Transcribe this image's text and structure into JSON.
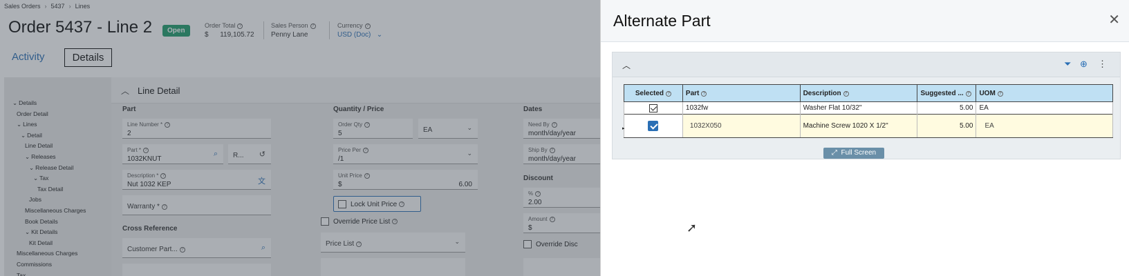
{
  "breadcrumb": [
    "Sales Orders",
    "5437",
    "Lines"
  ],
  "page": {
    "title": "Order 5437 - Line 2",
    "status": "Open",
    "order_total_label": "Order Total",
    "order_total_currency": "$",
    "order_total_value": "119,105.72",
    "sales_person_label": "Sales Person",
    "sales_person_value": "Penny Lane",
    "currency_label": "Currency",
    "currency_value": "USD (Doc)"
  },
  "tabs": {
    "activity": "Activity",
    "details": "Details"
  },
  "tree": [
    {
      "label": "Details",
      "indent": 0,
      "toggle": "⌄"
    },
    {
      "label": "Order Detail",
      "indent": 1,
      "toggle": ""
    },
    {
      "label": "Lines",
      "indent": 1,
      "toggle": "⌄"
    },
    {
      "label": "Detail",
      "indent": 2,
      "toggle": "⌄"
    },
    {
      "label": "Line Detail",
      "indent": 3,
      "toggle": ""
    },
    {
      "label": "Releases",
      "indent": 3,
      "toggle": "⌄"
    },
    {
      "label": "Release Detail",
      "indent": 4,
      "toggle": "⌄"
    },
    {
      "label": "Tax",
      "indent": 5,
      "toggle": "⌄"
    },
    {
      "label": "Tax Detail",
      "indent": 6,
      "toggle": ""
    },
    {
      "label": "Jobs",
      "indent": 4,
      "toggle": ""
    },
    {
      "label": "Miscellaneous Charges",
      "indent": 3,
      "toggle": ""
    },
    {
      "label": "Book Details",
      "indent": 3,
      "toggle": ""
    },
    {
      "label": "Kit Details",
      "indent": 3,
      "toggle": "⌄"
    },
    {
      "label": "Kit Detail",
      "indent": 4,
      "toggle": ""
    },
    {
      "label": "Miscellaneous Charges",
      "indent": 1,
      "toggle": ""
    },
    {
      "label": "Commissions",
      "indent": 1,
      "toggle": ""
    },
    {
      "label": "Tax",
      "indent": 1,
      "toggle": ""
    }
  ],
  "line_detail": {
    "section": "Line Detail",
    "part_head": "Part",
    "line_number_label": "Line Number *",
    "line_number": "2",
    "part_label": "Part *",
    "part_value": "1032KNUT",
    "rev_label": "R...",
    "description_label": "Description *",
    "description_value": "Nut 1032 KEP",
    "warranty_label": "Warranty *",
    "cross_ref_head": "Cross Reference",
    "customer_part_label": "Customer Part...",
    "qty_head": "Quantity / Price",
    "order_qty_label": "Order Qty",
    "order_qty": "5",
    "uom": "EA",
    "price_per_label": "Price Per",
    "price_per": "/1",
    "unit_price_label": "Unit Price",
    "unit_price_currency": "$",
    "unit_price": "6.00",
    "lock_unit_price": "Lock Unit Price",
    "override_price_list": "Override Price List",
    "price_list_label": "Price List",
    "dates_head": "Dates",
    "need_by_label": "Need By",
    "need_by_placeholder": "month/day/year",
    "ship_by_label": "Ship By",
    "ship_by_placeholder": "month/day/year",
    "discount_head": "Discount",
    "pct_label": "%",
    "pct_value": "2.00",
    "amount_label": "Amount",
    "amount_currency": "$",
    "override_disc": "Override Disc"
  },
  "panel": {
    "title": "Alternate Part",
    "full_screen": "Full Screen",
    "columns": [
      "Selected",
      "Part",
      "Description",
      "Suggested ...",
      "UOM"
    ],
    "rows": [
      {
        "selected": true,
        "part": "1032fw",
        "description": "Washer Flat 10/32\"",
        "suggested": "5.00",
        "uom": "EA"
      },
      {
        "selected": true,
        "part": "1032X050",
        "description": "Machine Screw 1020 X 1/2\"",
        "suggested": "5.00",
        "uom": "EA"
      }
    ]
  },
  "icons": {
    "search": "search-icon",
    "filter": "filter-icon",
    "add": "plus-circle-icon",
    "more": "kebab-menu-icon",
    "close": "close-icon",
    "translate": "translate-icon",
    "expand": "expand-arrows-icon"
  },
  "colors": {
    "accent": "#2a6fb5",
    "open_badge": "#1f9e6b",
    "grid_header": "#bfe0f3",
    "selected_row": "#fffbe0"
  }
}
